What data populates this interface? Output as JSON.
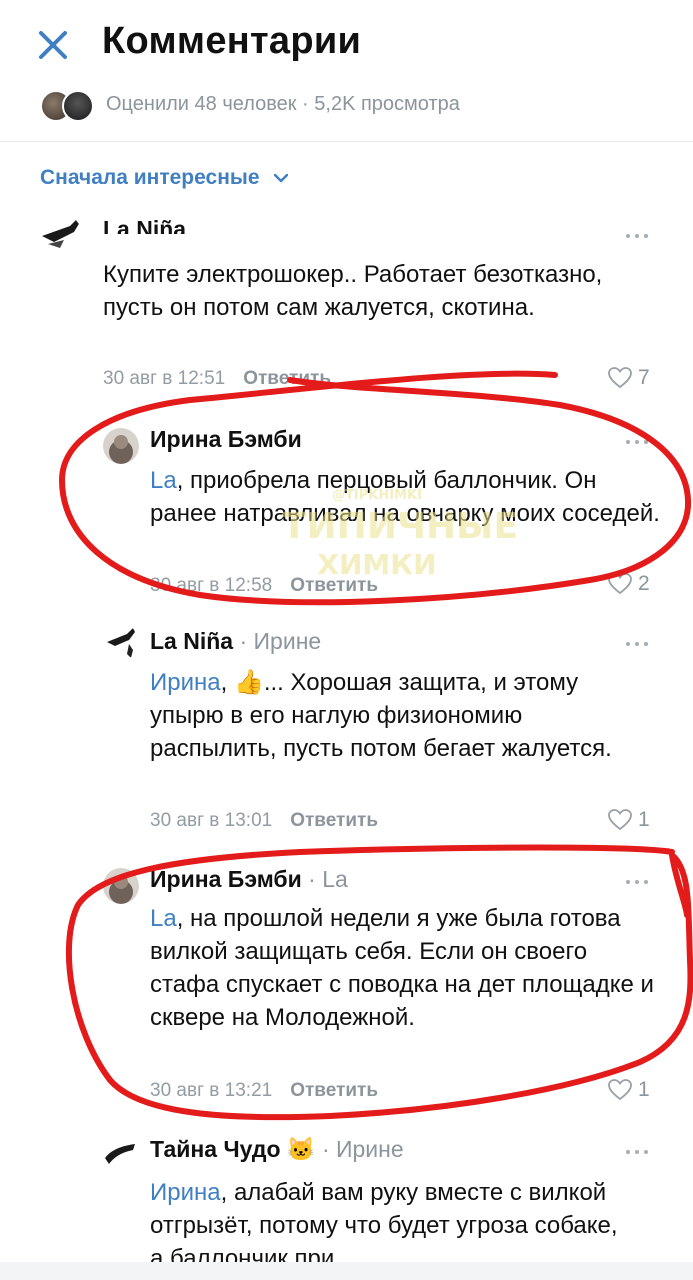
{
  "header": {
    "title": "Комментарии",
    "likes_text": "Оценили 48 человек · 5,2K просмотра"
  },
  "sort": {
    "label": "Сначала интересные"
  },
  "colors": {
    "accent": "#3f7fc2",
    "muted": "#8c949c",
    "annotation": "#e02020"
  },
  "comments": [
    {
      "author": "La Niña",
      "reply_to": "",
      "mention": "",
      "text": "Купите электрошокер.. Работает безотказно, пусть он потом сам жалуется, скотина.",
      "time": "30 авг в 12:51",
      "reply_label": "Ответить",
      "likes": "7"
    },
    {
      "author": "Ирина Бэмби",
      "reply_to": "",
      "mention": "La",
      "text": ", приобрела перцовый баллончик. Он ранее натравливал на овчарку моих соседей.",
      "time": "30 авг в 12:58",
      "reply_label": "Ответить",
      "likes": "2"
    },
    {
      "author": "La Niña",
      "reply_to": "· Ирине",
      "mention": "Ирина",
      "text": ", 👍... Хорошая защита, и этому упырю в его наглую физиономию распылить, пусть потом бегает жалуется.",
      "time": "30 авг в 13:01",
      "reply_label": "Ответить",
      "likes": "1"
    },
    {
      "author": "Ирина Бэмби",
      "reply_to": "· La",
      "mention": "La",
      "text": ", на прошлой недели я уже была готова вилкой защищать себя. Если он своего стафа спускает с поводка на дет площадке и сквере на Молодежной.",
      "time": "30 авг в 13:21",
      "reply_label": "Ответить",
      "likes": "1"
    },
    {
      "author": "Тайна Чудо 🐱",
      "reply_to": "· Ирине",
      "mention": "Ирина",
      "text": ", алабай вам руку вместе с вилкой отгрызёт, потому что будет угроза собаке, а баллончик при",
      "time": "",
      "reply_label": "",
      "likes": ""
    }
  ],
  "watermark": {
    "line1": "@TIPKHIMKI",
    "line2": "ТИПИЧНЫЕ",
    "line3": "ХИМКИ"
  }
}
